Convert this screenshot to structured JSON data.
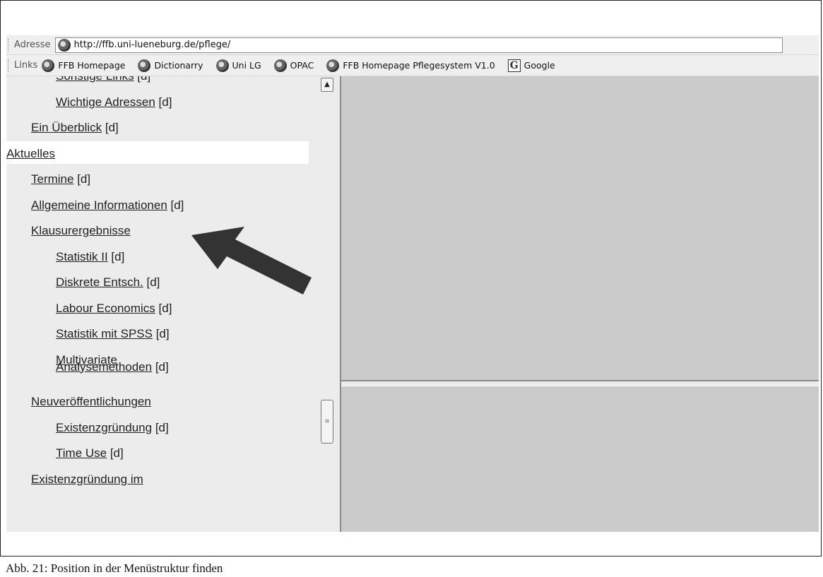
{
  "address_bar": {
    "label": "Adresse",
    "url": "http://ffb.uni-lueneburg.de/pflege/"
  },
  "links_bar": {
    "label": "Links",
    "items": [
      {
        "label": "FFB Homepage",
        "icon": "ie-icon"
      },
      {
        "label": "Dictionarry",
        "icon": "ie-icon"
      },
      {
        "label": "Uni LG",
        "icon": "ie-icon"
      },
      {
        "label": "OPAC",
        "icon": "ie-icon"
      },
      {
        "label": "FFB Homepage Pflegesystem V1.0",
        "icon": "ie-icon"
      },
      {
        "label": "Google",
        "icon": "google-icon"
      }
    ]
  },
  "nav": {
    "items": [
      {
        "label": "Sonstige Links",
        "suffix": " [d]",
        "level": 2,
        "clipped": true
      },
      {
        "label": "Wichtige Adressen",
        "suffix": " [d]",
        "level": 2
      },
      {
        "label": "Ein Überblick",
        "suffix": " [d]",
        "level": 1
      },
      {
        "label": "Aktuelles",
        "suffix": "",
        "level": 0,
        "active": true
      },
      {
        "label": "Termine",
        "suffix": " [d]",
        "level": 1
      },
      {
        "label": "Allgemeine Informationen",
        "suffix": " [d]",
        "level": 1
      },
      {
        "label": "Klausurergebnisse",
        "suffix": "",
        "level": 1
      },
      {
        "label": "Statistik II",
        "suffix": " [d]",
        "level": 2
      },
      {
        "label": "Diskrete Entsch.",
        "suffix": " [d]",
        "level": 2
      },
      {
        "label": "Labour Economics",
        "suffix": " [d]",
        "level": 2
      },
      {
        "label": "Statistik mit SPSS",
        "suffix": " [d]",
        "level": 2
      },
      {
        "label": "Multivariate",
        "suffix": "",
        "level": 2,
        "continued": true
      },
      {
        "label": "Analysemethoden",
        "suffix": " [d]",
        "level": 2
      },
      {
        "label": "Neuveröffentlichungen",
        "suffix": "",
        "level": 1
      },
      {
        "label": "Existenzgründung",
        "suffix": " [d]",
        "level": 2
      },
      {
        "label": "Time Use",
        "suffix": " [d]",
        "level": 2
      },
      {
        "label": "Existenzgründung im",
        "suffix": "",
        "level": 1,
        "clipped": true
      }
    ]
  },
  "caption": "Abb. 21: Position in der Menüstruktur finden",
  "colors": {
    "arrow": "#333333",
    "frame_bg": "#cbcbcb",
    "menu_bg": "#ececec"
  }
}
